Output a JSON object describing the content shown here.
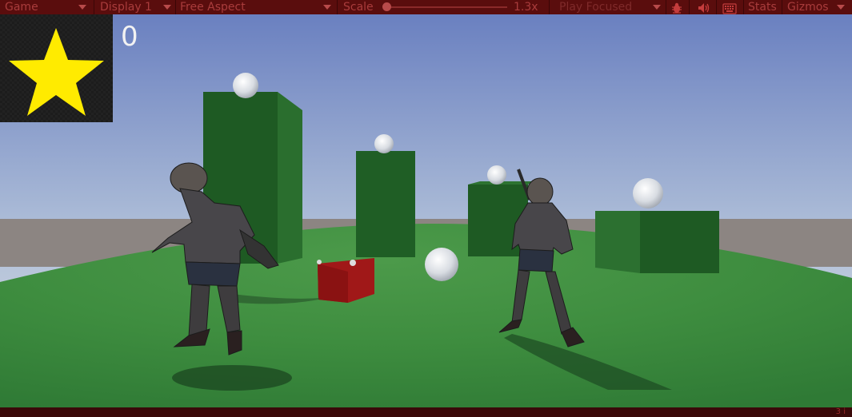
{
  "toolbar": {
    "game_tab": "Game",
    "display": "Display 1",
    "aspect": "Free Aspect",
    "scale_label": "Scale",
    "scale_value": "1.3x",
    "play_mode": "Play Focused",
    "stats": "Stats",
    "gizmos": "Gizmos",
    "icons": [
      "bug-icon",
      "audio-icon",
      "keyboard-icon"
    ]
  },
  "hud": {
    "score": "0",
    "star_icon": "star-icon"
  },
  "status_bar": {
    "text": "3 i"
  },
  "colors": {
    "toolbar_bg": "#5a0d0d",
    "toolbar_text": "#a93c3c",
    "ground": "#3b8f3d",
    "sky_top": "#6f86c3",
    "cube_green": "#1f5a24",
    "cube_red": "#a01818",
    "star": "#ffeb00"
  }
}
